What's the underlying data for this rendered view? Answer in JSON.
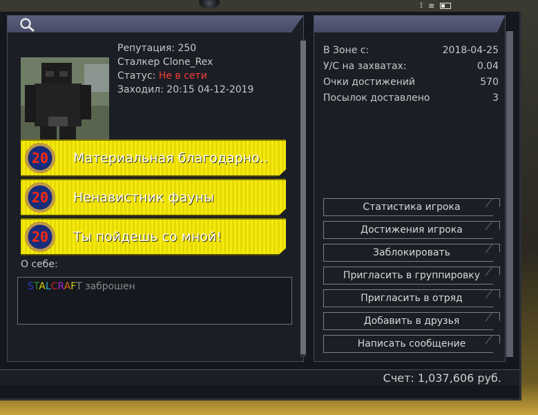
{
  "profile": {
    "reputation": "Репутация: 250",
    "stalker": "Сталкер Clone_Rex",
    "status_label": "Статус:",
    "status_value": "Не в сети",
    "last_seen": "Заходил: 20:15 04-12-2019"
  },
  "achievements": [
    {
      "badge": "20",
      "title": "Материальная благодарно.."
    },
    {
      "badge": "20",
      "title": "Ненавистник фауны"
    },
    {
      "badge": "20",
      "title": "Ты пойдешь со мной!"
    }
  ],
  "about": {
    "label": "О себе:",
    "logo_text": "STALCRAFT",
    "text": " заброшен"
  },
  "stats": [
    {
      "label": "В Зоне с:",
      "value": "2018-04-25"
    },
    {
      "label": "У/С на захватах:",
      "value": "0.04"
    },
    {
      "label": "Очки достижений",
      "value": "570"
    },
    {
      "label": "Посылок доставлено",
      "value": "3"
    }
  ],
  "actions": [
    "Статистика игрока",
    "Достижения игрока",
    "Заблокировать",
    "Пригласить в группировку",
    "Пригласить в отряд",
    "Добавить в друзья",
    "Написать сообщение"
  ],
  "footer": {
    "balance": "Счет: 1,037,606 руб."
  },
  "colors": {
    "offline": "#ff3b3b",
    "achievement_bg": "#f0e200",
    "header_bar": "#4b4f6c"
  }
}
